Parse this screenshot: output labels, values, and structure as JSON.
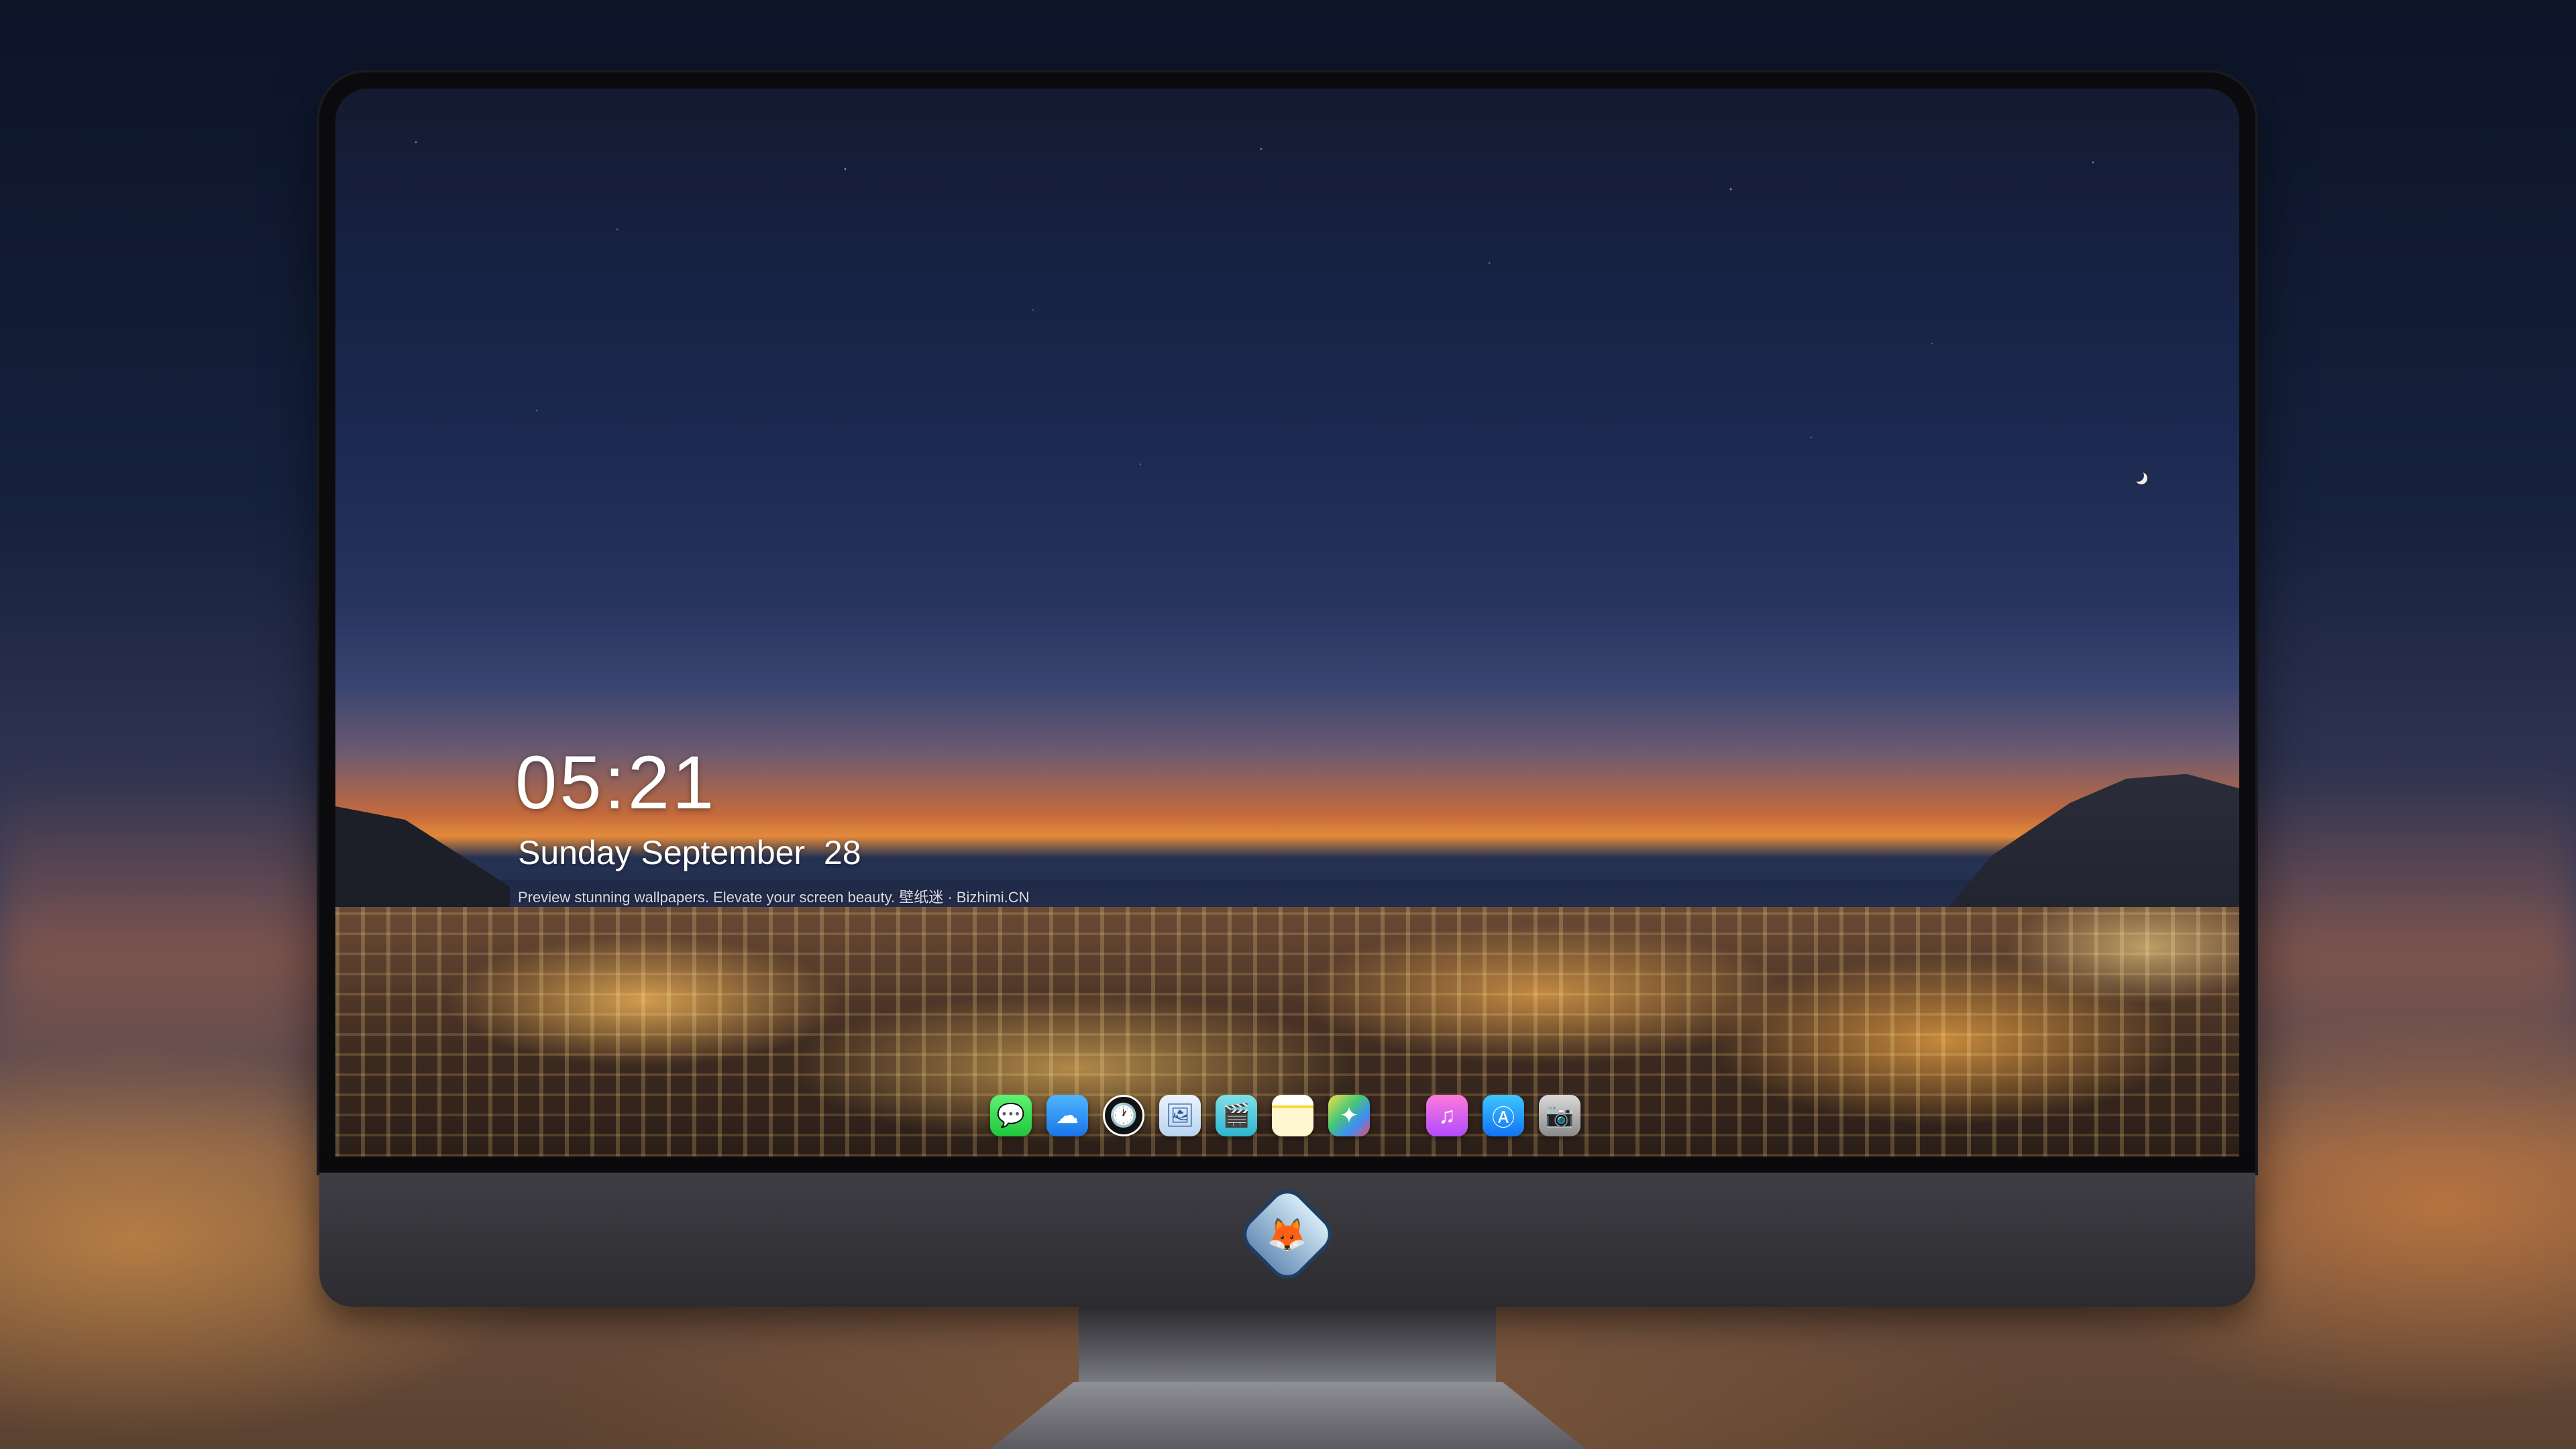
{
  "lock_screen": {
    "time": "05:21",
    "day": "Sunday",
    "month": "September",
    "date": "28",
    "caption": "Preview stunning wallpapers. Elevate your screen beauty. 壁纸迷 · Bizhimi.CN"
  },
  "dock": {
    "items": [
      {
        "name": "messages-icon",
        "glyph": "💬"
      },
      {
        "name": "weather-icon",
        "glyph": "☁"
      },
      {
        "name": "clock-icon",
        "glyph": "🕐"
      },
      {
        "name": "preview-icon",
        "glyph": "🖼"
      },
      {
        "name": "clips-icon",
        "glyph": "🎬"
      },
      {
        "name": "notes-icon",
        "glyph": ""
      },
      {
        "name": "photos-icon",
        "glyph": "✦"
      },
      {
        "name": "music-icon",
        "glyph": "♫"
      },
      {
        "name": "app-store-icon",
        "glyph": "Ⓐ"
      },
      {
        "name": "camera-icon",
        "glyph": "📷"
      }
    ]
  },
  "monitor": {
    "logo_icon": "fox-mascot-logo"
  }
}
